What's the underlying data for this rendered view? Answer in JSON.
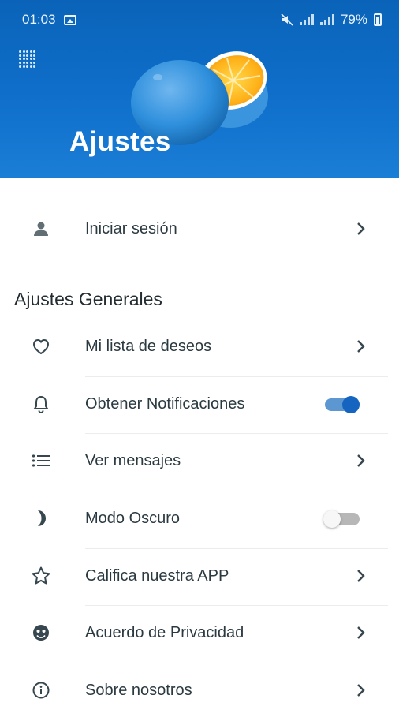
{
  "status_bar": {
    "time": "01:03",
    "battery": "79%"
  },
  "header": {
    "title": "Ajustes"
  },
  "account": {
    "login_label": "Iniciar sesión"
  },
  "general_section": {
    "title": "Ajustes Generales",
    "items": [
      {
        "label": "Mi lista de deseos",
        "icon": "heart-icon",
        "control": "chevron"
      },
      {
        "label": "Obtener Notificaciones",
        "icon": "bell-icon",
        "control": "toggle",
        "enabled": true
      },
      {
        "label": "Ver mensajes",
        "icon": "list-icon",
        "control": "chevron"
      },
      {
        "label": "Modo Oscuro",
        "icon": "moon-icon",
        "control": "toggle",
        "enabled": false
      },
      {
        "label": "Califica nuestra APP",
        "icon": "star-icon",
        "control": "chevron"
      },
      {
        "label": "Acuerdo de Privacidad",
        "icon": "privacy-icon",
        "control": "chevron"
      },
      {
        "label": "Sobre nosotros",
        "icon": "info-icon",
        "control": "chevron"
      }
    ]
  },
  "colors": {
    "header_blue": "#0f6fcb",
    "toggle_on": "#1565c0",
    "text": "#2b3a41"
  }
}
